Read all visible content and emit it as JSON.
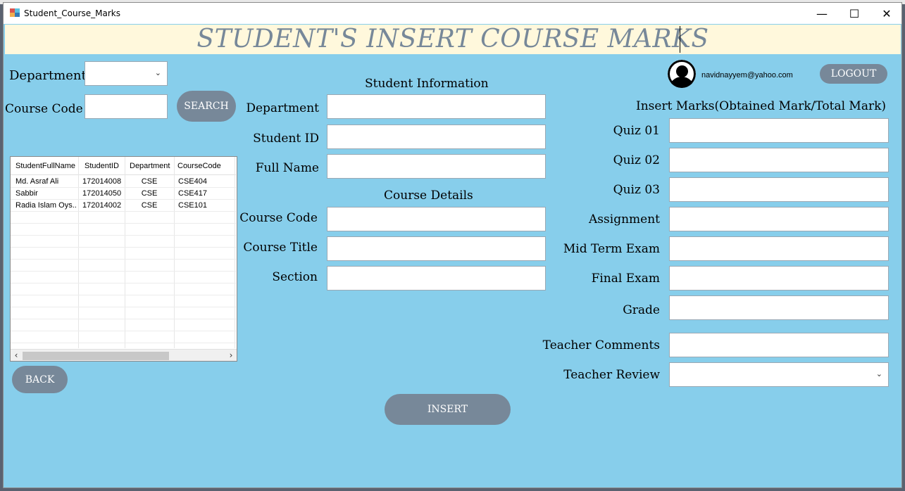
{
  "window": {
    "title": "Student_Course_Marks",
    "minimize": "—",
    "maximize": "☐",
    "close": "✕"
  },
  "banner": {
    "title": "STUDENT'S INSERT COURSE MARKS"
  },
  "search": {
    "department_label": "Department",
    "department_value": "",
    "course_code_label": "Course Code",
    "course_code_value": "",
    "search_button": "SEARCH"
  },
  "grid": {
    "columns": [
      "StudentFullName",
      "StudentID",
      "Department",
      "CourseCode"
    ],
    "rows": [
      [
        "Md. Asraf Ali",
        "172014008",
        "CSE",
        "CSE404"
      ],
      [
        "Sabbir",
        "172014050",
        "CSE",
        "CSE417"
      ],
      [
        "Radia Islam Oys...",
        "172014002",
        "CSE",
        "CSE101"
      ]
    ]
  },
  "back_button": "BACK",
  "student_info": {
    "header": "Student Information",
    "department_label": "Department",
    "department_value": "",
    "student_id_label": "Student ID",
    "student_id_value": "",
    "full_name_label": "Full Name",
    "full_name_value": ""
  },
  "course_details": {
    "header": "Course Details",
    "course_code_label": "Course Code",
    "course_code_value": "",
    "course_title_label": "Course Title",
    "course_title_value": "",
    "section_label": "Section",
    "section_value": ""
  },
  "user": {
    "email": "navidnayyem@yahoo.com",
    "logout_button": "LOGOUT",
    "avatar_icon": "user-avatar-icon"
  },
  "marks": {
    "header": "Insert Marks(Obtained Mark/Total Mark)",
    "quiz1_label": "Quiz 01",
    "quiz2_label": "Quiz 02",
    "quiz3_label": "Quiz 03",
    "assignment_label": "Assignment",
    "midterm_label": "Mid Term Exam",
    "final_label": "Final Exam",
    "grade_label": "Grade",
    "comments_label": "Teacher Comments",
    "review_label": "Teacher Review",
    "review_value": ""
  },
  "insert_button": "INSERT",
  "colors": {
    "form_bg": "#87ceeb",
    "banner_bg": "#fff8dc",
    "banner_text": "#778899",
    "button_bg": "#778899",
    "button_text": "#ffffff"
  }
}
